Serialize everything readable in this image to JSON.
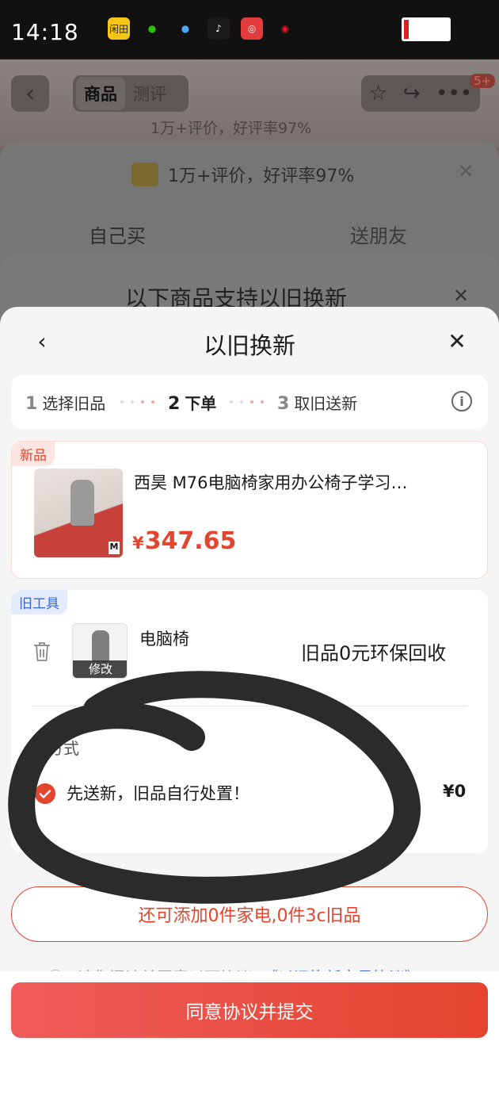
{
  "status_bar": {
    "time": "14:18",
    "apps": [
      {
        "name": "news-app-icon",
        "label": "闲田",
        "color": "#f5c518",
        "text_color": "#222"
      },
      {
        "name": "wechat-icon",
        "label": "●",
        "color": "#111",
        "text_color": "#2dc100"
      },
      {
        "name": "qq-icon",
        "label": "●",
        "color": "#111",
        "text_color": "#4aa8ff"
      },
      {
        "name": "tiktok-icon",
        "label": "♪",
        "color": "#1a1a1a",
        "text_color": "#fff"
      },
      {
        "name": "netease-music-icon",
        "label": "◎",
        "color": "#e23b3b",
        "text_color": "#fff"
      },
      {
        "name": "weibo-icon",
        "label": "◉",
        "color": "#111",
        "text_color": "#e6162d"
      }
    ]
  },
  "background_page": {
    "tabs": [
      "商品",
      "测评"
    ],
    "badge": "5+",
    "rating_top": "1万+评价，好评率97%",
    "rating_row": "1万+评价，好评率97%",
    "buy_self": "自己买",
    "buy_friend": "送朋友",
    "trade_in_title": "以下商品支持以旧换新"
  },
  "sheet": {
    "title": "以旧换新",
    "steps": [
      {
        "num": "1",
        "label": "选择旧品"
      },
      {
        "num": "2",
        "label": "下单"
      },
      {
        "num": "3",
        "label": "取旧送新"
      }
    ],
    "active_step": 2
  },
  "new_item": {
    "tag": "新品",
    "title": "西昊 M76电脑椅家用办公椅子学习…",
    "currency": "¥",
    "price": "347.65"
  },
  "old_item": {
    "tag": "旧工具",
    "name": "电脑椅",
    "edit_label": "修改",
    "recycle_text": "旧品0元环保回收",
    "method_label": "新方式",
    "option_text": "先送新，旧品自行处置！",
    "option_price": "¥0",
    "option_selected": true
  },
  "add_more": "还可添加0件家电,0件3c旧品",
  "agreement": {
    "text": "请您阅读并同意以下协议",
    "link": "《以旧换新交易协议》"
  },
  "submit_label": "同意协议并提交",
  "colors": {
    "accent": "#e3452e",
    "link": "#3a67d8",
    "scribble": "#2b2b2b"
  }
}
